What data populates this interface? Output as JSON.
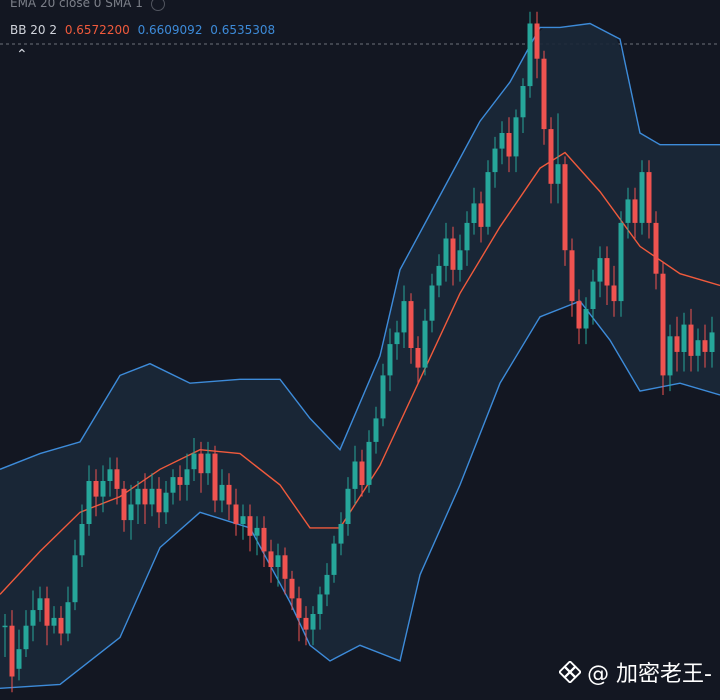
{
  "legend": {
    "ema": {
      "label": "EMA 20 close 0 SMA 1",
      "eye_icon": "eye-icon"
    },
    "bb": {
      "label": "BB 20 2",
      "basis": "0.6572200",
      "upper": "0.6609092",
      "lower": "0.6535308"
    }
  },
  "collapse_icon": "chevron-up-icon",
  "watermark": {
    "text": "@ 加密老王-",
    "logo_icon": "binance-logo"
  },
  "colors": {
    "background": "#131722",
    "up": "#26a69a",
    "down": "#ef5350",
    "basis": "#f05a3c",
    "band": "#3d8bd9",
    "band_fill": "#1b2838"
  },
  "chart_data": {
    "type": "candlestick",
    "indicator": "Bollinger Bands (20, 2)",
    "ylim": [
      0.6455,
      0.6634
    ],
    "basis": [
      [
        0,
        0.6482
      ],
      [
        40,
        0.6493
      ],
      [
        80,
        0.6503
      ],
      [
        120,
        0.6507
      ],
      [
        160,
        0.6514
      ],
      [
        200,
        0.6519
      ],
      [
        240,
        0.6518
      ],
      [
        280,
        0.651
      ],
      [
        310,
        0.6499
      ],
      [
        340,
        0.6499
      ],
      [
        380,
        0.6515
      ],
      [
        420,
        0.6537
      ],
      [
        460,
        0.6559
      ],
      [
        500,
        0.6576
      ],
      [
        540,
        0.6591
      ],
      [
        565,
        0.6595
      ],
      [
        600,
        0.6585
      ],
      [
        640,
        0.6571
      ],
      [
        680,
        0.6564
      ],
      [
        720,
        0.6561
      ]
    ],
    "upper": [
      [
        0,
        0.6514
      ],
      [
        40,
        0.6518
      ],
      [
        80,
        0.6521
      ],
      [
        120,
        0.6538
      ],
      [
        150,
        0.6541
      ],
      [
        190,
        0.6536
      ],
      [
        240,
        0.6537
      ],
      [
        280,
        0.6537
      ],
      [
        310,
        0.6527
      ],
      [
        340,
        0.6519
      ],
      [
        380,
        0.6543
      ],
      [
        400,
        0.6565
      ],
      [
        440,
        0.6584
      ],
      [
        480,
        0.6603
      ],
      [
        510,
        0.6613
      ],
      [
        540,
        0.6627
      ],
      [
        560,
        0.6627
      ],
      [
        590,
        0.6628
      ],
      [
        620,
        0.6624
      ],
      [
        640,
        0.66
      ],
      [
        660,
        0.6597
      ],
      [
        720,
        0.6597
      ]
    ],
    "lower": [
      [
        0,
        0.6458
      ],
      [
        60,
        0.6459
      ],
      [
        120,
        0.6471
      ],
      [
        160,
        0.6494
      ],
      [
        200,
        0.6503
      ],
      [
        250,
        0.6499
      ],
      [
        290,
        0.648
      ],
      [
        310,
        0.6469
      ],
      [
        330,
        0.6465
      ],
      [
        360,
        0.6469
      ],
      [
        400,
        0.6465
      ],
      [
        420,
        0.6487
      ],
      [
        460,
        0.651
      ],
      [
        500,
        0.6536
      ],
      [
        540,
        0.6553
      ],
      [
        580,
        0.6557
      ],
      [
        610,
        0.6547
      ],
      [
        640,
        0.6534
      ],
      [
        680,
        0.6536
      ],
      [
        720,
        0.6533
      ]
    ],
    "candles": [
      [
        5,
        0.6474,
        0.6474,
        0.6466,
        0.6477
      ],
      [
        12,
        0.6474,
        0.6461,
        0.6457,
        0.6478
      ],
      [
        19,
        0.6463,
        0.6468,
        0.646,
        0.6473
      ],
      [
        26,
        0.6468,
        0.6474,
        0.6466,
        0.6478
      ],
      [
        33,
        0.6474,
        0.6478,
        0.647,
        0.6483
      ],
      [
        40,
        0.6478,
        0.6481,
        0.6475,
        0.6484
      ],
      [
        47,
        0.6481,
        0.6474,
        0.6469,
        0.6484
      ],
      [
        54,
        0.6474,
        0.6476,
        0.6472,
        0.6479
      ],
      [
        61,
        0.6476,
        0.6472,
        0.6469,
        0.6479
      ],
      [
        68,
        0.6472,
        0.648,
        0.647,
        0.6484
      ],
      [
        75,
        0.648,
        0.6492,
        0.6478,
        0.6496
      ],
      [
        82,
        0.6492,
        0.65,
        0.6489,
        0.6505
      ],
      [
        89,
        0.65,
        0.6511,
        0.6497,
        0.6515
      ],
      [
        96,
        0.6511,
        0.6507,
        0.6502,
        0.6514
      ],
      [
        103,
        0.6507,
        0.6511,
        0.6503,
        0.6515
      ],
      [
        110,
        0.6511,
        0.6514,
        0.6507,
        0.6517
      ],
      [
        117,
        0.6514,
        0.6509,
        0.6505,
        0.6517
      ],
      [
        124,
        0.6509,
        0.6501,
        0.6498,
        0.6511
      ],
      [
        131,
        0.6501,
        0.6505,
        0.6496,
        0.651
      ],
      [
        138,
        0.6505,
        0.6509,
        0.65,
        0.6511
      ],
      [
        145,
        0.6509,
        0.6505,
        0.65,
        0.6513
      ],
      [
        152,
        0.6505,
        0.6509,
        0.6502,
        0.6513
      ],
      [
        159,
        0.6509,
        0.6503,
        0.6499,
        0.6512
      ],
      [
        166,
        0.6503,
        0.6508,
        0.65,
        0.6511
      ],
      [
        173,
        0.6508,
        0.6512,
        0.6505,
        0.6514
      ],
      [
        180,
        0.6512,
        0.651,
        0.6506,
        0.6515
      ],
      [
        187,
        0.651,
        0.6514,
        0.6506,
        0.6518
      ],
      [
        194,
        0.6514,
        0.6518,
        0.6511,
        0.6522
      ],
      [
        201,
        0.6518,
        0.6513,
        0.6508,
        0.6521
      ],
      [
        208,
        0.6513,
        0.6518,
        0.651,
        0.6521
      ],
      [
        215,
        0.6518,
        0.6506,
        0.6503,
        0.652
      ],
      [
        222,
        0.6506,
        0.651,
        0.6503,
        0.6514
      ],
      [
        229,
        0.651,
        0.6505,
        0.6501,
        0.6513
      ],
      [
        236,
        0.6505,
        0.65,
        0.6497,
        0.6509
      ],
      [
        243,
        0.65,
        0.6502,
        0.6496,
        0.6505
      ],
      [
        250,
        0.6502,
        0.6497,
        0.6493,
        0.6505
      ],
      [
        257,
        0.6497,
        0.6499,
        0.6492,
        0.6502
      ],
      [
        264,
        0.6499,
        0.6493,
        0.6489,
        0.6502
      ],
      [
        271,
        0.6493,
        0.6489,
        0.6485,
        0.6496
      ],
      [
        278,
        0.6489,
        0.6492,
        0.6484,
        0.6495
      ],
      [
        285,
        0.6492,
        0.6486,
        0.6482,
        0.6494
      ],
      [
        292,
        0.6486,
        0.6481,
        0.6478,
        0.6488
      ],
      [
        299,
        0.6481,
        0.6476,
        0.647,
        0.6484
      ],
      [
        306,
        0.6476,
        0.6473,
        0.6469,
        0.6479
      ],
      [
        313,
        0.6473,
        0.6477,
        0.6469,
        0.6479
      ],
      [
        320,
        0.6477,
        0.6482,
        0.6473,
        0.6484
      ],
      [
        327,
        0.6482,
        0.6487,
        0.6479,
        0.649
      ],
      [
        334,
        0.6487,
        0.6495,
        0.6485,
        0.6497
      ],
      [
        341,
        0.6495,
        0.65,
        0.6492,
        0.6503
      ],
      [
        348,
        0.65,
        0.6509,
        0.6497,
        0.6512
      ],
      [
        355,
        0.6509,
        0.6516,
        0.6505,
        0.652
      ],
      [
        362,
        0.6516,
        0.651,
        0.6507,
        0.6519
      ],
      [
        369,
        0.651,
        0.6521,
        0.6508,
        0.6524
      ],
      [
        376,
        0.6521,
        0.6527,
        0.6518,
        0.653
      ],
      [
        383,
        0.6527,
        0.6538,
        0.6525,
        0.6541
      ],
      [
        390,
        0.6538,
        0.6546,
        0.6534,
        0.655
      ],
      [
        397,
        0.6546,
        0.6549,
        0.6542,
        0.6552
      ],
      [
        404,
        0.6549,
        0.6557,
        0.6545,
        0.6561
      ],
      [
        411,
        0.6557,
        0.6545,
        0.6541,
        0.6559
      ],
      [
        418,
        0.6545,
        0.654,
        0.6536,
        0.6548
      ],
      [
        425,
        0.654,
        0.6552,
        0.6538,
        0.6555
      ],
      [
        432,
        0.6552,
        0.6561,
        0.6549,
        0.6564
      ],
      [
        439,
        0.6561,
        0.6566,
        0.6558,
        0.6569
      ],
      [
        446,
        0.6566,
        0.6573,
        0.6562,
        0.6577
      ],
      [
        453,
        0.6573,
        0.6565,
        0.6561,
        0.6576
      ],
      [
        460,
        0.6565,
        0.657,
        0.6562,
        0.6574
      ],
      [
        467,
        0.657,
        0.6577,
        0.6566,
        0.658
      ],
      [
        474,
        0.6577,
        0.6582,
        0.6574,
        0.6586
      ],
      [
        481,
        0.6582,
        0.6576,
        0.6572,
        0.6585
      ],
      [
        488,
        0.6576,
        0.659,
        0.6574,
        0.6593
      ],
      [
        495,
        0.659,
        0.6596,
        0.6586,
        0.6599
      ],
      [
        502,
        0.6596,
        0.66,
        0.6592,
        0.6603
      ],
      [
        509,
        0.66,
        0.6594,
        0.659,
        0.6604
      ],
      [
        516,
        0.6594,
        0.6604,
        0.659,
        0.6606
      ],
      [
        523,
        0.6604,
        0.6612,
        0.66,
        0.6614
      ],
      [
        530,
        0.6612,
        0.6628,
        0.6609,
        0.6631
      ],
      [
        537,
        0.6628,
        0.6619,
        0.6614,
        0.6631
      ],
      [
        544,
        0.6619,
        0.6601,
        0.6597,
        0.6621
      ],
      [
        551,
        0.6601,
        0.6587,
        0.6582,
        0.6604
      ],
      [
        558,
        0.6587,
        0.6592,
        0.6582,
        0.6605
      ],
      [
        565,
        0.6592,
        0.657,
        0.6566,
        0.6594
      ],
      [
        572,
        0.657,
        0.6557,
        0.6553,
        0.6573
      ],
      [
        579,
        0.6557,
        0.655,
        0.6546,
        0.656
      ],
      [
        586,
        0.655,
        0.6555,
        0.6546,
        0.6558
      ],
      [
        593,
        0.6555,
        0.6562,
        0.6551,
        0.6565
      ],
      [
        600,
        0.6562,
        0.6568,
        0.6558,
        0.6571
      ],
      [
        607,
        0.6568,
        0.6561,
        0.6556,
        0.6571
      ],
      [
        614,
        0.6561,
        0.6557,
        0.6553,
        0.6566
      ],
      [
        621,
        0.6557,
        0.6577,
        0.6553,
        0.658
      ],
      [
        628,
        0.6577,
        0.6583,
        0.6573,
        0.6586
      ],
      [
        635,
        0.6583,
        0.6577,
        0.6573,
        0.6586
      ],
      [
        642,
        0.6577,
        0.659,
        0.6574,
        0.6593
      ],
      [
        649,
        0.659,
        0.6577,
        0.6573,
        0.6593
      ],
      [
        656,
        0.6577,
        0.6564,
        0.656,
        0.658
      ],
      [
        663,
        0.6564,
        0.6538,
        0.6533,
        0.6567
      ],
      [
        670,
        0.6538,
        0.6548,
        0.6534,
        0.6551
      ],
      [
        677,
        0.6548,
        0.6544,
        0.6539,
        0.6553
      ],
      [
        684,
        0.6544,
        0.6551,
        0.6539,
        0.6554
      ],
      [
        691,
        0.6551,
        0.6543,
        0.6539,
        0.6555
      ],
      [
        698,
        0.6543,
        0.6547,
        0.6539,
        0.655
      ],
      [
        705,
        0.6547,
        0.6544,
        0.654,
        0.6551
      ],
      [
        712,
        0.6544,
        0.6549,
        0.654,
        0.6553
      ]
    ]
  }
}
